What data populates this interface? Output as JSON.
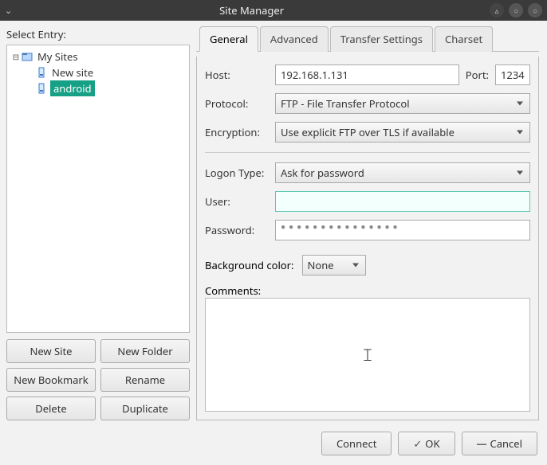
{
  "title": "Site Manager",
  "left": {
    "label": "Select Entry:",
    "root": "My Sites",
    "items": [
      {
        "label": "New site",
        "selected": false
      },
      {
        "label": "android",
        "selected": true
      }
    ],
    "buttons": {
      "new_site": "New Site",
      "new_folder": "New Folder",
      "new_bookmark": "New Bookmark",
      "rename": "Rename",
      "delete": "Delete",
      "duplicate": "Duplicate"
    }
  },
  "tabs": {
    "general": "General",
    "advanced": "Advanced",
    "transfer": "Transfer Settings",
    "charset": "Charset",
    "active": "general"
  },
  "form": {
    "host_label": "Host:",
    "host_value": "192.168.1.131",
    "port_label": "Port:",
    "port_value": "1234",
    "protocol_label": "Protocol:",
    "protocol_value": "FTP - File Transfer Protocol",
    "encryption_label": "Encryption:",
    "encryption_value": "Use explicit FTP over TLS if available",
    "logon_label": "Logon Type:",
    "logon_value": "Ask for password",
    "user_label": "User:",
    "user_value": "",
    "password_label": "Password:",
    "password_value": "●●●●●●●●●●●●●●●",
    "bg_label": "Background color:",
    "bg_value": "None",
    "comments_label": "Comments:"
  },
  "footer": {
    "connect": "Connect",
    "ok": "OK",
    "cancel": "Cancel"
  }
}
